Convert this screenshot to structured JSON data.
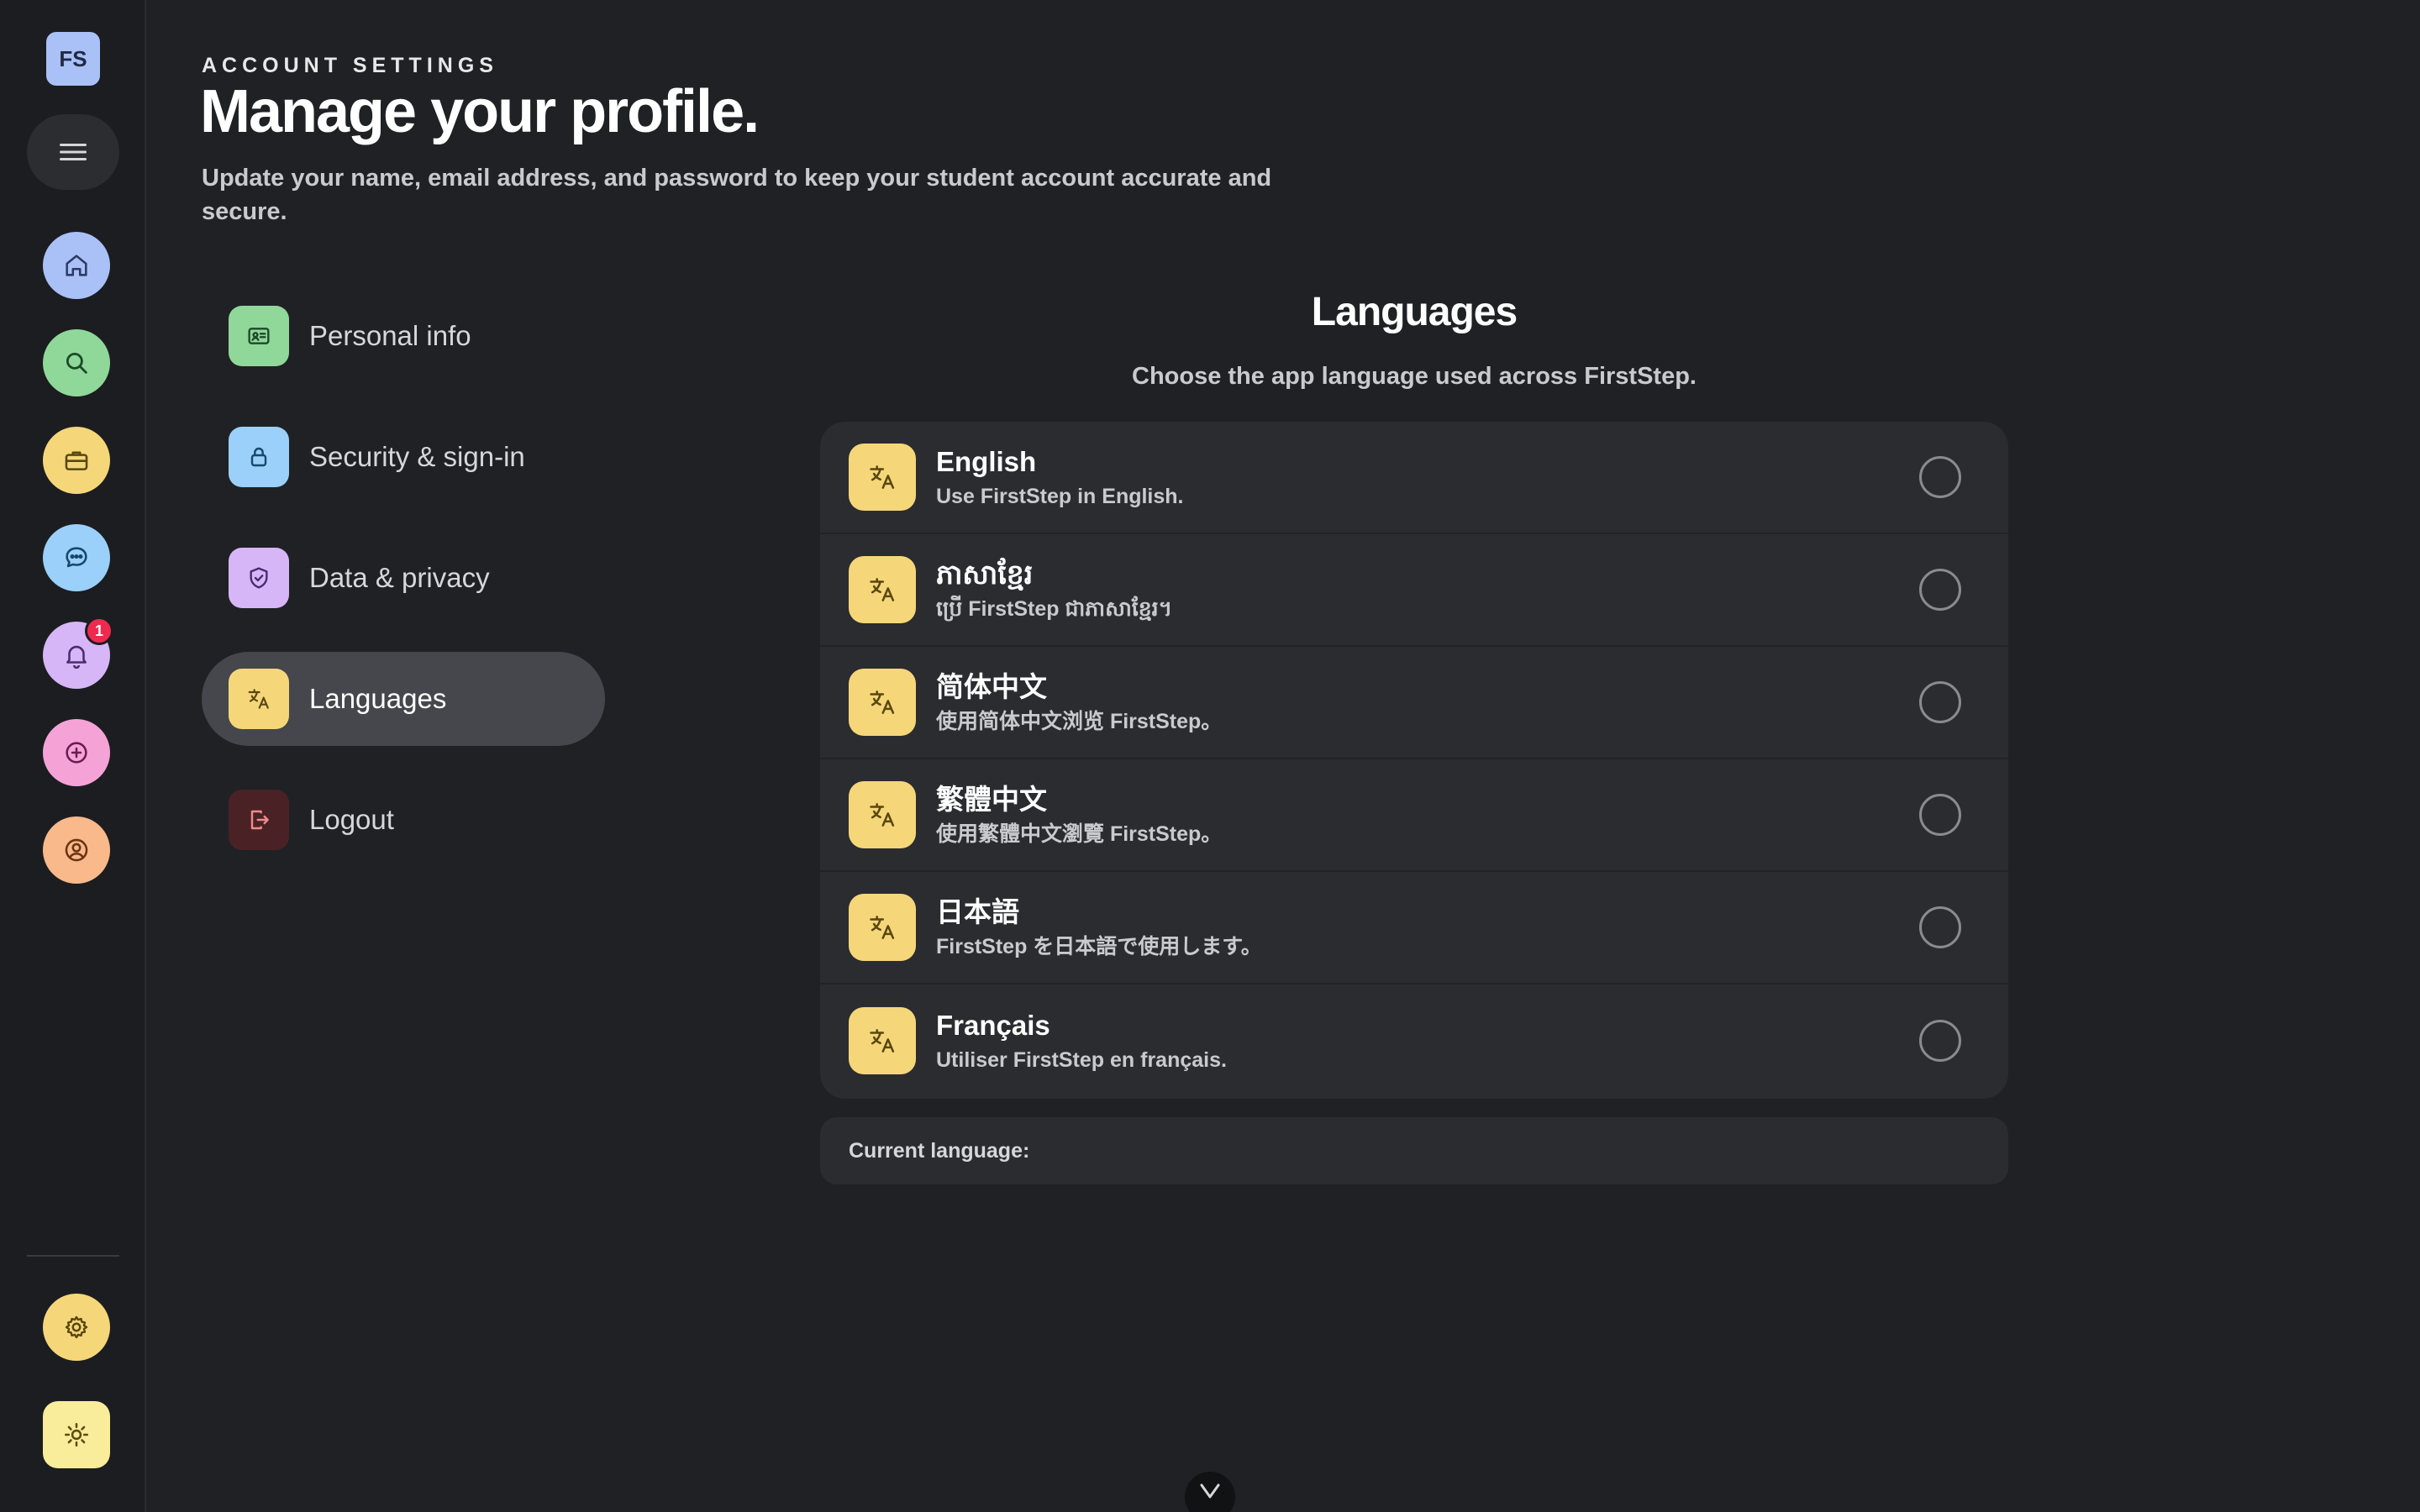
{
  "sidebar": {
    "brand": "FS",
    "notification_count": "1",
    "items": [
      {
        "name": "home",
        "color": "#a9c1f7"
      },
      {
        "name": "search",
        "color": "#8fd89a"
      },
      {
        "name": "jobs",
        "color": "#f5d77a"
      },
      {
        "name": "messages",
        "color": "#9ad0f9"
      },
      {
        "name": "notifications",
        "color": "#d7b6f7"
      },
      {
        "name": "create",
        "color": "#f5a3d7"
      },
      {
        "name": "profile",
        "color": "#f9b98a"
      },
      {
        "name": "settings",
        "color": "#f5d77a"
      },
      {
        "name": "theme",
        "color": "#f9ec9a"
      }
    ]
  },
  "header": {
    "eyebrow": "ACCOUNT SETTINGS",
    "title": "Manage your profile.",
    "description": "Update your name, email address, and password to keep your student account accurate and secure."
  },
  "settings_nav": {
    "items": [
      {
        "label": "Personal info",
        "color": "#8fd89a"
      },
      {
        "label": "Security & sign-in",
        "color": "#9ad0f9"
      },
      {
        "label": "Data & privacy",
        "color": "#d7b6f7"
      },
      {
        "label": "Languages",
        "color": "#f5d77a",
        "active": true
      },
      {
        "label": "Logout",
        "color": "#4a2226"
      }
    ]
  },
  "languages": {
    "title": "Languages",
    "subtitle": "Choose the app language used across FirstStep.",
    "options": [
      {
        "name": "English",
        "description": "Use FirstStep in English.",
        "selected": false
      },
      {
        "name": "ភាសាខ្មែរ",
        "description": "ប្រើ FirstStep ជាភាសាខ្មែរ។",
        "selected": false
      },
      {
        "name": "简体中文",
        "description": "使用简体中文浏览 FirstStep。",
        "selected": false
      },
      {
        "name": "繁體中文",
        "description": "使用繁體中文瀏覽 FirstStep。",
        "selected": false
      },
      {
        "name": "日本語",
        "description": "FirstStep を日本語で使用します。",
        "selected": false
      },
      {
        "name": "Français",
        "description": "Utiliser FirstStep en français.",
        "selected": false
      }
    ],
    "current_label": "Current language:",
    "current_value": ""
  }
}
